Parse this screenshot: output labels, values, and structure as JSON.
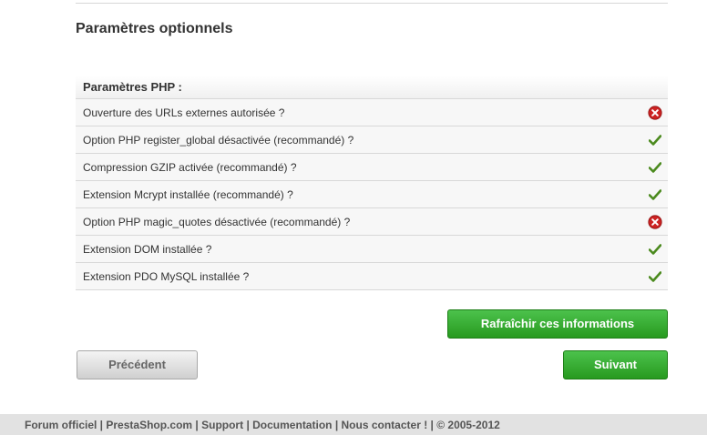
{
  "section_title": "Paramètres optionnels",
  "php_table": {
    "header": "Paramètres PHP :",
    "rows": [
      {
        "label": "Ouverture des URLs externes autorisée ?",
        "status": "error"
      },
      {
        "label": "Option PHP register_global désactivée (recommandé) ?",
        "status": "ok"
      },
      {
        "label": "Compression GZIP activée (recommandé) ?",
        "status": "ok"
      },
      {
        "label": "Extension Mcrypt installée (recommandé) ?",
        "status": "ok"
      },
      {
        "label": "Option PHP magic_quotes désactivée (recommandé) ?",
        "status": "error"
      },
      {
        "label": "Extension DOM installée ?",
        "status": "ok"
      },
      {
        "label": "Extension PDO MySQL installée ?",
        "status": "ok"
      }
    ]
  },
  "buttons": {
    "refresh": "Rafraîchir ces informations",
    "previous": "Précédent",
    "next": "Suivant"
  },
  "footer": {
    "forum": "Forum officiel",
    "site": "PrestaShop.com",
    "support": "Support",
    "docs": "Documentation",
    "contact": "Nous contacter !",
    "copyright": "© 2005-2012"
  },
  "colors": {
    "ok": "#4b8a1e",
    "error": "#cc2222",
    "primary": "#279a1f"
  }
}
